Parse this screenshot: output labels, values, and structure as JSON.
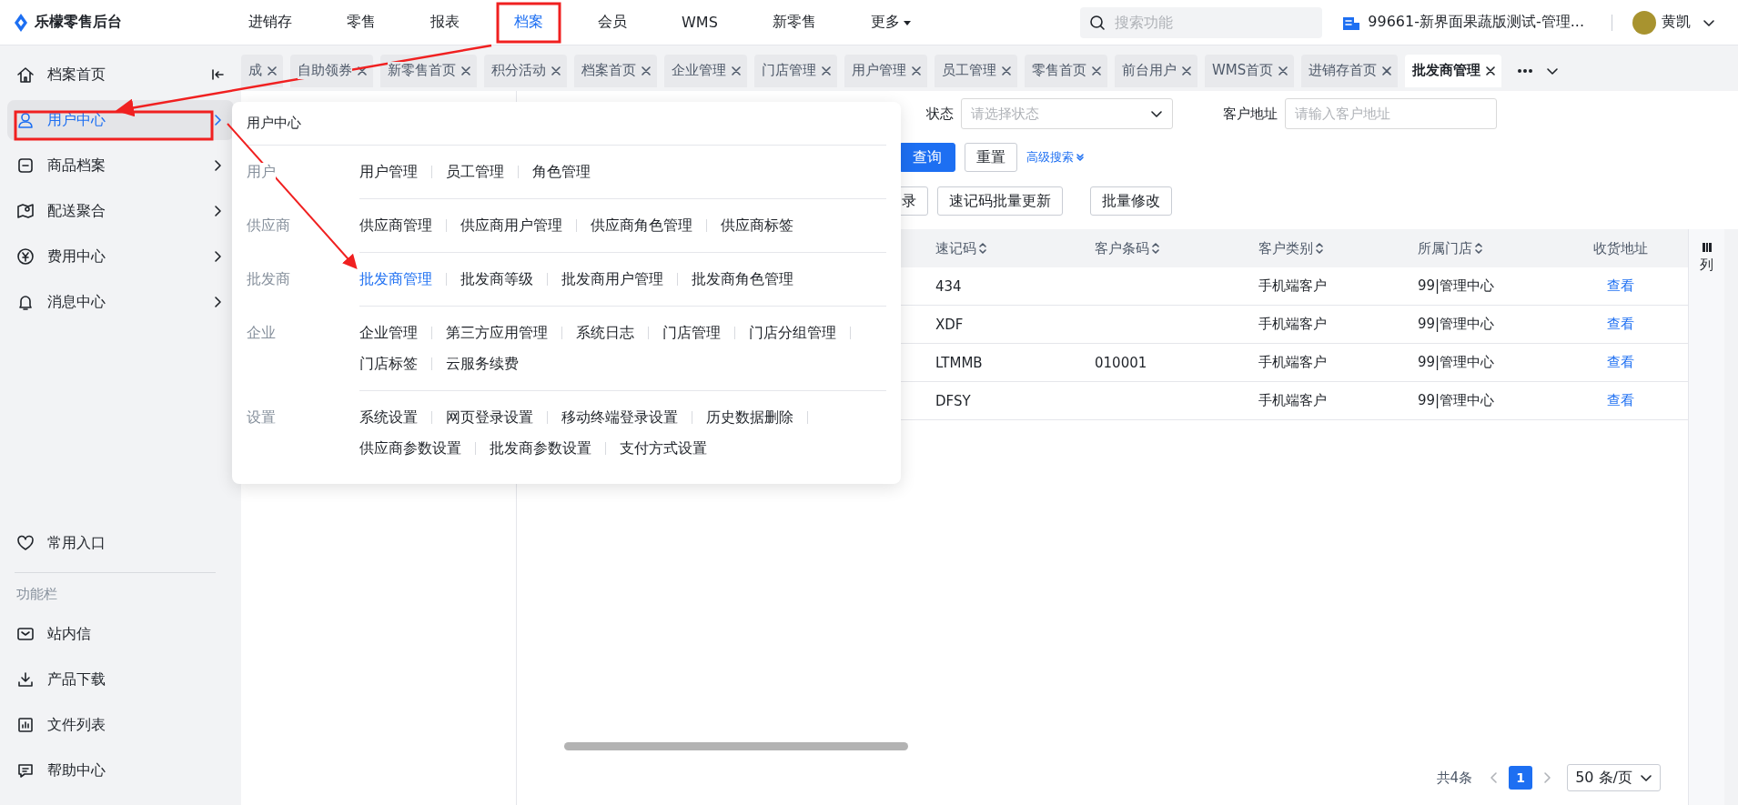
{
  "app": {
    "logo": "乐檬零售后台"
  },
  "top_nav": [
    {
      "label": "进销存",
      "selected": false,
      "kind": "link"
    },
    {
      "label": "零售",
      "selected": false,
      "kind": "link"
    },
    {
      "label": "报表",
      "selected": false,
      "kind": "link"
    },
    {
      "label": "档案",
      "selected": true,
      "kind": "link"
    },
    {
      "label": "会员",
      "selected": false,
      "kind": "link"
    },
    {
      "label": "WMS",
      "selected": false,
      "kind": "link"
    },
    {
      "label": "新零售",
      "selected": false,
      "kind": "link"
    },
    {
      "label": "更多",
      "selected": false,
      "kind": "dropdown"
    }
  ],
  "search": {
    "placeholder": "搜索功能"
  },
  "store": {
    "name": "99661-新界面果蔬版测试-管理..."
  },
  "user": {
    "name": "黄凯"
  },
  "sidebar": {
    "home": {
      "label": "档案首页"
    },
    "items": [
      {
        "label": "用户中心",
        "selected": true
      },
      {
        "label": "商品档案",
        "selected": false
      },
      {
        "label": "配送聚合",
        "selected": false
      },
      {
        "label": "费用中心",
        "selected": false
      },
      {
        "label": "消息中心",
        "selected": false
      }
    ],
    "favorites": {
      "label": "常用入口"
    },
    "section_title": "功能栏",
    "tools": [
      {
        "label": "站内信"
      },
      {
        "label": "产品下载"
      },
      {
        "label": "文件列表"
      },
      {
        "label": "帮助中心"
      }
    ]
  },
  "tabs": [
    {
      "label": "成",
      "selected": false
    },
    {
      "label": "自助领券",
      "selected": false
    },
    {
      "label": "新零售首页",
      "selected": false
    },
    {
      "label": "积分活动",
      "selected": false
    },
    {
      "label": "档案首页",
      "selected": false
    },
    {
      "label": "企业管理",
      "selected": false
    },
    {
      "label": "门店管理",
      "selected": false
    },
    {
      "label": "用户管理",
      "selected": false
    },
    {
      "label": "员工管理",
      "selected": false
    },
    {
      "label": "零售首页",
      "selected": false
    },
    {
      "label": "前台用户",
      "selected": false
    },
    {
      "label": "WMS首页",
      "selected": false
    },
    {
      "label": "进销存首页",
      "selected": false
    },
    {
      "label": "批发商管理",
      "selected": true
    }
  ],
  "filters": [
    {
      "label": "状态",
      "placeholder": "请选择状态",
      "kind": "select"
    },
    {
      "label": "客户地址",
      "placeholder": "请输入客户地址",
      "kind": "input"
    }
  ],
  "search_buttons": [
    {
      "label": "查询",
      "kind": "primary"
    },
    {
      "label": "重置",
      "kind": "default"
    }
  ],
  "advanced_search": "高级搜索",
  "toolbar": [
    "录",
    "速记码批量更新",
    "批量修改"
  ],
  "table": {
    "columns": [
      {
        "label": "速记码",
        "sortable": true
      },
      {
        "label": "客户条码",
        "sortable": true
      },
      {
        "label": "客户类别",
        "sortable": true
      },
      {
        "label": "所属门店",
        "sortable": true
      },
      {
        "label": "收货地址",
        "sortable": false
      }
    ],
    "column_settings": "列",
    "rows": [
      {
        "cells": [
          "434",
          "",
          "手机端客户",
          "99|管理中心"
        ],
        "link": "查看"
      },
      {
        "cells": [
          "XDF",
          "",
          "手机端客户",
          "99|管理中心"
        ],
        "link": "查看"
      },
      {
        "cells": [
          "LTMMB",
          "010001",
          "手机端客户",
          "99|管理中心"
        ],
        "link": "查看"
      },
      {
        "cells": [
          "DFSY",
          "",
          "手机端客户",
          "99|管理中心"
        ],
        "link": "查看"
      }
    ]
  },
  "pagination": {
    "total": "共4条",
    "pages": [
      {
        "label": "1",
        "selected": true
      }
    ],
    "page_size": "50 条/页"
  },
  "popup": {
    "title": "用户中心",
    "groups": [
      {
        "label": "用户",
        "items": [
          {
            "label": "用户管理",
            "selected": false
          },
          {
            "label": "员工管理",
            "selected": false
          },
          {
            "label": "角色管理",
            "selected": false
          }
        ]
      },
      {
        "label": "供应商",
        "items": [
          {
            "label": "供应商管理",
            "selected": false
          },
          {
            "label": "供应商用户管理",
            "selected": false
          },
          {
            "label": "供应商角色管理",
            "selected": false
          },
          {
            "label": "供应商标签",
            "selected": false
          }
        ]
      },
      {
        "label": "批发商",
        "items": [
          {
            "label": "批发商管理",
            "selected": true
          },
          {
            "label": "批发商等级",
            "selected": false
          },
          {
            "label": "批发商用户管理",
            "selected": false
          },
          {
            "label": "批发商角色管理",
            "selected": false
          }
        ]
      },
      {
        "label": "企业",
        "items": [
          {
            "label": "企业管理",
            "selected": false
          },
          {
            "label": "第三方应用管理",
            "selected": false
          },
          {
            "label": "系统日志",
            "selected": false
          },
          {
            "label": "门店管理",
            "selected": false
          },
          {
            "label": "门店分组管理",
            "selected": false
          },
          {
            "label": "门店标签",
            "selected": false
          },
          {
            "label": "云服务续费",
            "selected": false
          }
        ]
      },
      {
        "label": "设置",
        "items": [
          {
            "label": "系统设置",
            "selected": false
          },
          {
            "label": "网页登录设置",
            "selected": false
          },
          {
            "label": "移动终端登录设置",
            "selected": false
          },
          {
            "label": "历史数据删除",
            "selected": false
          },
          {
            "label": "供应商参数设置",
            "selected": false
          },
          {
            "label": "批发商参数设置",
            "selected": false
          },
          {
            "label": "支付方式设置",
            "selected": false
          }
        ]
      }
    ]
  }
}
